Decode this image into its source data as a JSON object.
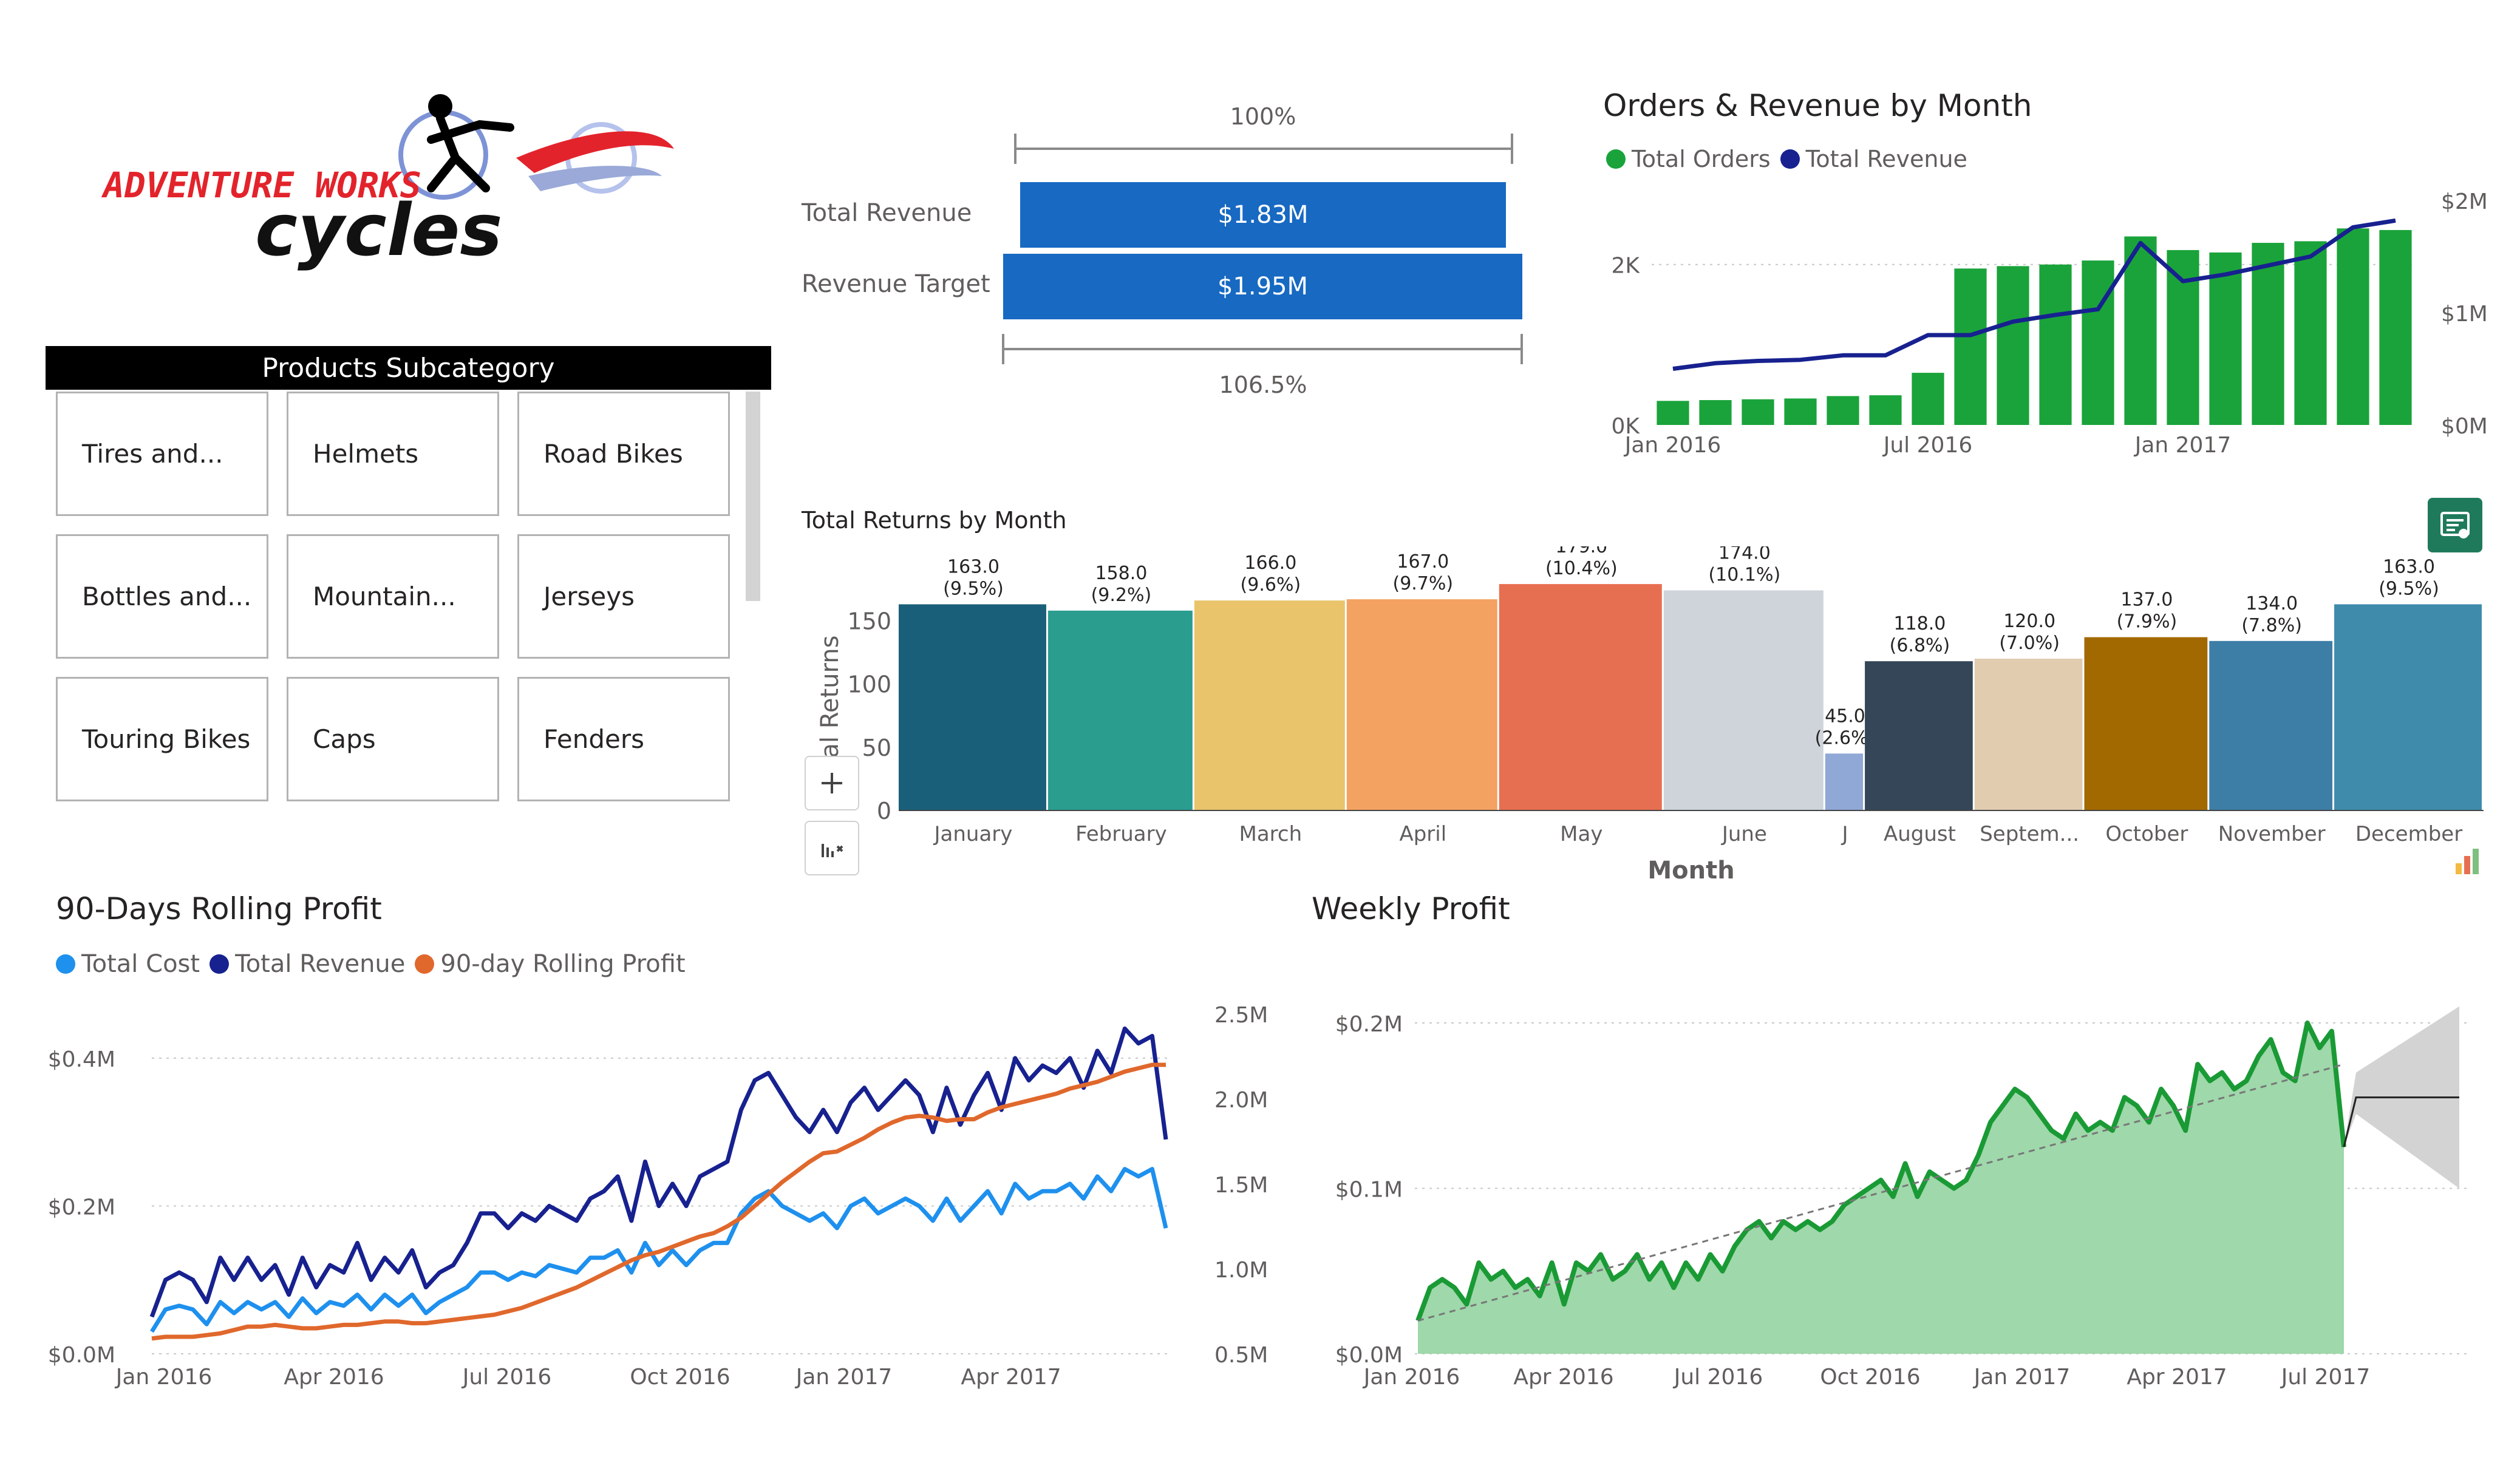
{
  "logo": {
    "line1": "ADVENTURE WORKS",
    "line2": "cycles"
  },
  "slicer": {
    "title": "Products Subcategory",
    "items": [
      "Tires and...",
      "Helmets",
      "Road Bikes",
      "Bottles and...",
      "Mountain...",
      "Jerseys",
      "Touring Bikes",
      "Caps",
      "Fenders"
    ]
  },
  "kpi": {
    "top_pct": "100%",
    "bottom_pct": "106.5%",
    "rows": [
      {
        "label": "Total Revenue",
        "value": "$1.83M"
      },
      {
        "label": "Revenue Target",
        "value": "$1.95M"
      }
    ],
    "revenue_fraction_of_target": 0.939
  },
  "orders_revenue": {
    "title": "Orders & Revenue by Month",
    "legend": [
      {
        "name": "Total Orders",
        "color": "#1aa33a"
      },
      {
        "name": "Total Revenue",
        "color": "#17218f"
      }
    ]
  },
  "returns": {
    "title": "Total Returns by Month",
    "xlabel": "Month",
    "ylabel": "al Returns"
  },
  "rolling": {
    "title": "90-Days Rolling Profit",
    "legend": [
      {
        "name": "Total Cost",
        "color": "#1e90ee"
      },
      {
        "name": "Total Revenue",
        "color": "#17218f"
      },
      {
        "name": "90-day Rolling Profit",
        "color": "#e0682c"
      }
    ]
  },
  "weekly": {
    "title": "Weekly Profit"
  },
  "chart_data": [
    {
      "type": "bar",
      "name": "orders-revenue",
      "categories": [
        "Jan 2016",
        "Feb 2016",
        "Mar 2016",
        "Apr 2016",
        "May 2016",
        "Jun 2016",
        "Jul 2016",
        "Aug 2016",
        "Sep 2016",
        "Oct 2016",
        "Nov 2016",
        "Dec 2016",
        "Jan 2017",
        "Feb 2017",
        "Mar 2017",
        "Apr 2017",
        "May 2017",
        "Jun 2017"
      ],
      "x_ticks": [
        "Jan 2016",
        "Jul 2016",
        "Jan 2017"
      ],
      "series": [
        {
          "name": "Total Orders",
          "type": "bar",
          "axis": "left",
          "values": [
            300,
            310,
            320,
            330,
            360,
            370,
            650,
            1950,
            1980,
            2000,
            2050,
            2350,
            2180,
            2150,
            2270,
            2290,
            2450,
            2430
          ]
        },
        {
          "name": "Total Revenue",
          "type": "line",
          "axis": "right",
          "values": [
            0.5,
            0.55,
            0.57,
            0.58,
            0.62,
            0.62,
            0.8,
            0.8,
            0.92,
            0.98,
            1.03,
            1.62,
            1.28,
            1.34,
            1.42,
            1.5,
            1.76,
            1.82
          ]
        }
      ],
      "y_left": {
        "range": [
          0,
          2800
        ],
        "ticks": [
          {
            "v": 0,
            "label": "0K"
          },
          {
            "v": 2000,
            "label": "2K"
          }
        ]
      },
      "y_right": {
        "range": [
          0,
          2.0
        ],
        "ticks": [
          {
            "v": 0,
            "label": "$0M"
          },
          {
            "v": 1,
            "label": "$1M"
          },
          {
            "v": 2,
            "label": "$2M"
          }
        ]
      }
    },
    {
      "type": "bar",
      "name": "returns-by-month",
      "categories": [
        "January",
        "February",
        "March",
        "April",
        "May",
        "June",
        "J",
        "August",
        "Septem...",
        "October",
        "November",
        "December"
      ],
      "values": [
        163.0,
        158.0,
        166.0,
        167.0,
        179.0,
        174.0,
        45.0,
        118.0,
        120.0,
        137.0,
        134.0,
        163.0
      ],
      "percent_labels": [
        "(9.5%)",
        "(9.2%)",
        "(9.6%)",
        "(9.7%)",
        "(10.4%)",
        "(10.1%)",
        "(2.6%)",
        "(6.8%)",
        "(7.0%)",
        "(7.9%)",
        "(7.8%)",
        "(9.5%)"
      ],
      "value_labels": [
        "163.0",
        "158.0",
        "166.0",
        "167.0",
        "179.0",
        "174.0",
        "45.0",
        "118.0",
        "120.0",
        "137.0",
        "134.0",
        "163.0"
      ],
      "colors": [
        "#1a5f7a",
        "#2a9d8f",
        "#e9c46a",
        "#f4a261",
        "#e76f51",
        "#ced4da",
        "#8fa8d6",
        "#344658",
        "#e1ccb0",
        "#a26900",
        "#3d7ea6",
        "#3e8bab"
      ],
      "xlabel": "Month",
      "ylabel": "al Returns",
      "y_ticks": [
        0,
        50,
        100,
        150
      ],
      "ylim": [
        0,
        180
      ]
    },
    {
      "type": "line",
      "name": "rolling-profit",
      "x_ticks": [
        "Jan 2016",
        "Apr 2016",
        "Jul 2016",
        "Oct 2016",
        "Jan 2017",
        "Apr 2017"
      ],
      "weeks": 73,
      "series": [
        {
          "name": "Total Revenue",
          "axis": "left",
          "values": [
            0.05,
            0.1,
            0.11,
            0.1,
            0.07,
            0.13,
            0.1,
            0.13,
            0.1,
            0.12,
            0.08,
            0.13,
            0.09,
            0.12,
            0.11,
            0.15,
            0.1,
            0.13,
            0.11,
            0.14,
            0.09,
            0.11,
            0.12,
            0.15,
            0.19,
            0.19,
            0.17,
            0.19,
            0.18,
            0.2,
            0.19,
            0.18,
            0.21,
            0.22,
            0.24,
            0.18,
            0.26,
            0.2,
            0.23,
            0.2,
            0.24,
            0.25,
            0.26,
            0.33,
            0.37,
            0.38,
            0.35,
            0.32,
            0.3,
            0.33,
            0.3,
            0.34,
            0.36,
            0.33,
            0.35,
            0.37,
            0.35,
            0.3,
            0.36,
            0.31,
            0.35,
            0.38,
            0.33,
            0.4,
            0.37,
            0.39,
            0.38,
            0.4,
            0.36,
            0.41,
            0.38,
            0.44,
            0.42,
            0.43,
            0.29
          ]
        },
        {
          "name": "Total Cost",
          "axis": "left",
          "values": [
            0.03,
            0.06,
            0.065,
            0.06,
            0.04,
            0.07,
            0.055,
            0.07,
            0.06,
            0.07,
            0.05,
            0.075,
            0.055,
            0.07,
            0.065,
            0.08,
            0.06,
            0.08,
            0.065,
            0.08,
            0.055,
            0.07,
            0.08,
            0.09,
            0.11,
            0.11,
            0.1,
            0.11,
            0.105,
            0.12,
            0.115,
            0.11,
            0.13,
            0.13,
            0.14,
            0.11,
            0.15,
            0.12,
            0.14,
            0.12,
            0.14,
            0.15,
            0.15,
            0.19,
            0.21,
            0.22,
            0.2,
            0.19,
            0.18,
            0.19,
            0.17,
            0.2,
            0.21,
            0.19,
            0.2,
            0.21,
            0.2,
            0.18,
            0.21,
            0.18,
            0.2,
            0.22,
            0.19,
            0.23,
            0.21,
            0.22,
            0.22,
            0.23,
            0.21,
            0.24,
            0.22,
            0.25,
            0.24,
            0.25,
            0.17
          ]
        },
        {
          "name": "90-day Rolling Profit",
          "axis": "right",
          "values": [
            0.59,
            0.6,
            0.6,
            0.6,
            0.61,
            0.62,
            0.64,
            0.66,
            0.66,
            0.67,
            0.66,
            0.65,
            0.65,
            0.66,
            0.67,
            0.67,
            0.68,
            0.69,
            0.69,
            0.68,
            0.68,
            0.69,
            0.7,
            0.71,
            0.72,
            0.73,
            0.75,
            0.77,
            0.8,
            0.83,
            0.86,
            0.89,
            0.93,
            0.97,
            1.01,
            1.05,
            1.08,
            1.1,
            1.13,
            1.16,
            1.19,
            1.21,
            1.25,
            1.3,
            1.37,
            1.44,
            1.51,
            1.57,
            1.63,
            1.68,
            1.69,
            1.73,
            1.77,
            1.82,
            1.86,
            1.89,
            1.9,
            1.89,
            1.87,
            1.88,
            1.88,
            1.92,
            1.95,
            1.97,
            1.99,
            2.01,
            2.03,
            2.06,
            2.08,
            2.1,
            2.13,
            2.16,
            2.18,
            2.2,
            2.2
          ]
        }
      ],
      "y_left": {
        "range": [
          0,
          0.46
        ],
        "ticks": [
          {
            "v": 0,
            "label": "$0.0M"
          },
          {
            "v": 0.2,
            "label": "$0.2M"
          },
          {
            "v": 0.4,
            "label": "$0.4M"
          }
        ]
      },
      "y_right": {
        "range": [
          0.5,
          2.5
        ],
        "ticks": [
          {
            "v": 0.5,
            "label": "0.5M"
          },
          {
            "v": 1.0,
            "label": "1.0M"
          },
          {
            "v": 1.5,
            "label": "1.5M"
          },
          {
            "v": 2.0,
            "label": "2.0M"
          },
          {
            "v": 2.5,
            "label": "2.5M"
          }
        ]
      }
    },
    {
      "type": "area",
      "name": "weekly-profit",
      "x_ticks": [
        "Jan 2016",
        "Apr 2016",
        "Jul 2016",
        "Oct 2016",
        "Jan 2017",
        "Apr 2017",
        "Jul 2017"
      ],
      "series": [
        {
          "name": "Weekly Profit",
          "values": [
            0.02,
            0.04,
            0.045,
            0.04,
            0.03,
            0.055,
            0.045,
            0.05,
            0.04,
            0.045,
            0.035,
            0.055,
            0.03,
            0.055,
            0.05,
            0.06,
            0.045,
            0.05,
            0.06,
            0.045,
            0.055,
            0.04,
            0.055,
            0.045,
            0.06,
            0.05,
            0.065,
            0.075,
            0.08,
            0.07,
            0.08,
            0.075,
            0.08,
            0.075,
            0.08,
            0.09,
            0.095,
            0.1,
            0.105,
            0.095,
            0.115,
            0.095,
            0.11,
            0.105,
            0.1,
            0.105,
            0.12,
            0.14,
            0.15,
            0.16,
            0.155,
            0.145,
            0.135,
            0.13,
            0.145,
            0.135,
            0.14,
            0.135,
            0.155,
            0.15,
            0.14,
            0.16,
            0.15,
            0.135,
            0.175,
            0.165,
            0.17,
            0.16,
            0.165,
            0.18,
            0.19,
            0.17,
            0.165,
            0.2,
            0.185,
            0.195,
            0.125
          ]
        }
      ],
      "trend": [
        0.0,
        0.175
      ],
      "forecast": {
        "value": 0.155,
        "upper": 0.2,
        "lower": 0.1,
        "weeks": 7
      },
      "ylim": [
        0,
        0.2
      ],
      "y_ticks": [
        {
          "v": 0,
          "label": "$0.0M"
        },
        {
          "v": 0.1,
          "label": "$0.1M"
        },
        {
          "v": 0.2,
          "label": "$0.2M"
        }
      ]
    }
  ]
}
